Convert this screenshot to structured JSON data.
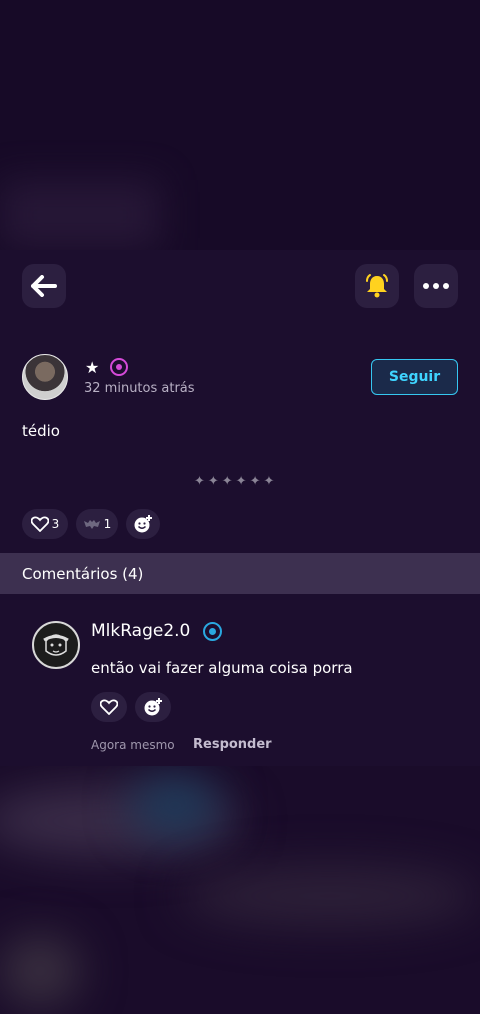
{
  "header": {
    "back_icon": "arrow-left-icon",
    "bell_icon": "bell-icon",
    "more_icon": "more-horizontal-icon",
    "bell_color": "#ffd21f"
  },
  "post": {
    "star": "★",
    "time": "32 minutos atrás",
    "follow_label": "Seguir",
    "text": "tédio",
    "divider": "✦✦✦✦✦✦",
    "like_count": "3",
    "gift_count": "1"
  },
  "comments": {
    "header": "Comentários (4)",
    "items": [
      {
        "author": "MlkRage2.0",
        "text": "então vai fazer alguma coisa porra",
        "time": "Agora mesmo",
        "reply_label": "Responder"
      }
    ]
  },
  "colors": {
    "accent_blue": "#36c7f0",
    "accent_pink": "#d44ad8",
    "bell_yellow": "#ffd21f"
  }
}
